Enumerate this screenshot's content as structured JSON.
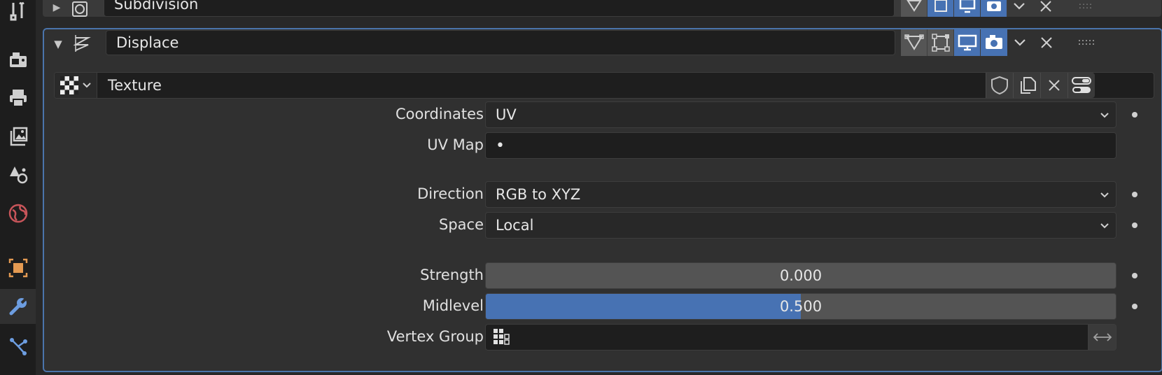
{
  "sidebar": {
    "tabs": [
      {
        "name": "tool-tab",
        "icon": "wrench-screwdriver-icon",
        "active": false
      },
      {
        "name": "render-tab",
        "icon": "camera-back-icon",
        "active": false
      },
      {
        "name": "output-tab",
        "icon": "printer-icon",
        "active": false
      },
      {
        "name": "view-layer-tab",
        "icon": "image-stack-icon",
        "active": false
      },
      {
        "name": "scene-tab",
        "icon": "scene-icon",
        "active": false
      },
      {
        "name": "world-tab",
        "icon": "world-icon",
        "active": false
      },
      {
        "name": "object-tab",
        "icon": "object-square-icon",
        "active": false
      },
      {
        "name": "modifier-tab",
        "icon": "wrench-icon",
        "active": true
      },
      {
        "name": "particles-tab",
        "icon": "particles-icon",
        "active": false
      }
    ]
  },
  "modifiers": {
    "subdivision": {
      "name": "Subdivision",
      "collapsed": true
    },
    "displace": {
      "name": "Displace",
      "expanded": true,
      "texture": {
        "name": "Texture"
      },
      "coordinates": {
        "label": "Coordinates",
        "value": "UV"
      },
      "uv_map": {
        "label": "UV Map",
        "value": "•"
      },
      "direction": {
        "label": "Direction",
        "value": "RGB to XYZ"
      },
      "space": {
        "label": "Space",
        "value": "Local"
      },
      "strength": {
        "label": "Strength",
        "value": "0.000",
        "fraction": 0.0
      },
      "midlevel": {
        "label": "Midlevel",
        "value": "0.500",
        "fraction": 0.5
      },
      "vertex_group": {
        "label": "Vertex Group",
        "value": ""
      }
    }
  },
  "colors": {
    "accent": "#4772b3",
    "panel_border": "#4a74ab",
    "object_orange": "#e49a52",
    "world_red": "#c8555a"
  }
}
